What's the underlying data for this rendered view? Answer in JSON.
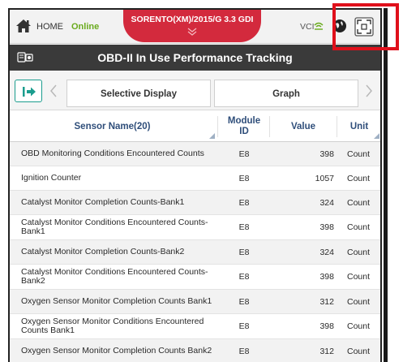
{
  "topbar": {
    "home_label": "HOME",
    "status_label": "Online",
    "vehicle": "SORENTO(XM)/2015/G 3.3 GDI",
    "vci_label": "VCI",
    "icons": [
      "home-icon",
      "chevron-down-icon",
      "vci-signal-icon",
      "globe-icon",
      "fullscreen-icon"
    ]
  },
  "titlebar": {
    "title": "OBD-II In Use Performance Tracking",
    "icon": "car-scan-icon"
  },
  "toolbar": {
    "selective_display_label": "Selective Display",
    "graph_label": "Graph",
    "icons": [
      "exit-icon",
      "chevron-left-icon",
      "chevron-right-icon"
    ]
  },
  "table": {
    "columns": {
      "name": "Sensor Name(20)",
      "module_line1": "Module",
      "module_line2": "ID",
      "value": "Value",
      "unit": "Unit"
    },
    "rows": [
      {
        "name": "OBD Monitoring Conditions Encountered Counts",
        "module": "E8",
        "value": "398",
        "unit": "Count"
      },
      {
        "name": "Ignition Counter",
        "module": "E8",
        "value": "1057",
        "unit": "Count"
      },
      {
        "name": "Catalyst Monitor Completion Counts-Bank1",
        "module": "E8",
        "value": "324",
        "unit": "Count"
      },
      {
        "name": "Catalyst Monitor Conditions Encountered Counts-Bank1",
        "module": "E8",
        "value": "398",
        "unit": "Count"
      },
      {
        "name": "Catalyst Monitor Completion Counts-Bank2",
        "module": "E8",
        "value": "324",
        "unit": "Count"
      },
      {
        "name": "Catalyst Monitor Conditions Encountered Counts-Bank2",
        "module": "E8",
        "value": "398",
        "unit": "Count"
      },
      {
        "name": "Oxygen Sensor Monitor Completion Counts Bank1",
        "module": "E8",
        "value": "312",
        "unit": "Count"
      },
      {
        "name": "Oxygen Sensor Monitor Conditions Encountered Counts Bank1",
        "module": "E8",
        "value": "398",
        "unit": "Count"
      },
      {
        "name": "Oxygen Sensor Monitor Completion Counts Bank2",
        "module": "E8",
        "value": "312",
        "unit": "Count"
      }
    ]
  },
  "colors": {
    "vehicle_tab": "#d32a3d",
    "online": "#6aab1e",
    "title_bar": "#3a3a3a",
    "accent_teal": "#1b9d8e",
    "header_text": "#2f4e7a",
    "annotation_red": "#e0101b"
  }
}
